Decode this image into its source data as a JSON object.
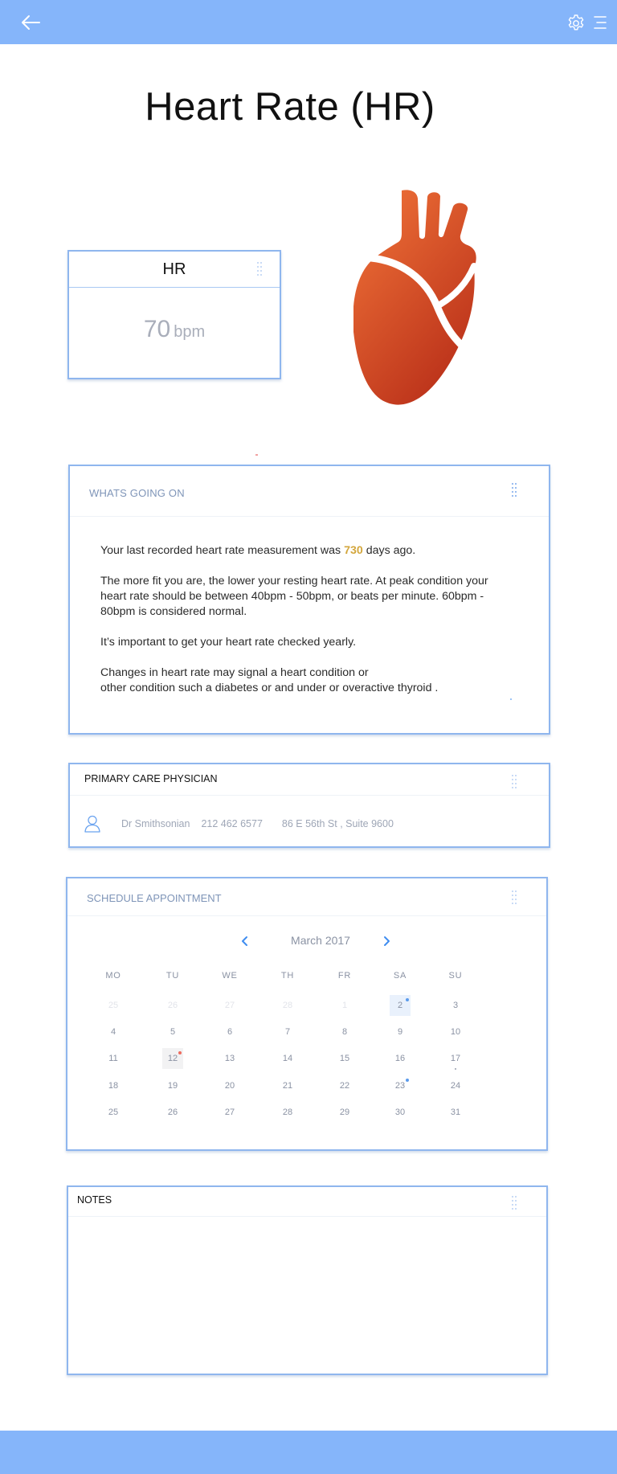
{
  "header": {
    "back_icon": "arrow-left-icon",
    "settings_icon": "gear-icon",
    "menu_icon": "hamburger-menu-icon",
    "bar_color": "#85B5FA"
  },
  "page": {
    "title": "Heart Rate (HR)"
  },
  "hr_card": {
    "label": "HR",
    "value": "70",
    "unit": "bpm"
  },
  "illustration": {
    "icon": "heart-organ-icon",
    "color": "#D94B25"
  },
  "whats_going_on": {
    "title": "WHATS GOING ON",
    "last_measurement_prefix": "Your last recorded heart rate measurement was ",
    "days_value": "730",
    "last_measurement_suffix": " days ago.",
    "fitness_lines": [
      "The more fit you are, the lower your resting heart rate.  At peak condition your",
      "heart rate should be between 40bpm - 50bpm, or beats per minute. 60bpm -",
      "80bpm is considered normal."
    ],
    "checkup": "It’s important to get your heart rate checked yearly.",
    "signal_lines": [
      "Changes in heart rate may signal a heart condition or",
      "other condition such a diabetes or and under or overactive thyroid ."
    ],
    "highlight_color": "#D3A63C"
  },
  "primary_care": {
    "title": "PRIMARY CARE PHYSICIAN",
    "avatar_icon": "user-icon",
    "name": "Dr Smithsonian",
    "phone": "212 462 6577",
    "address": "86 E 56th St , Suite 9600"
  },
  "schedule": {
    "title": "SCHEDULE APPOINTMENT",
    "month": "March 2017",
    "prev_icon": "chevron-left-icon",
    "next_icon": "chevron-right-icon",
    "weekdays": [
      "MO",
      "TU",
      "WE",
      "TH",
      "FR",
      "SA",
      "SU"
    ],
    "weeks": [
      [
        {
          "label": "25",
          "muted": true
        },
        {
          "label": "26",
          "muted": true
        },
        {
          "label": "27",
          "muted": true
        },
        {
          "label": "28",
          "muted": true
        },
        {
          "label": "1",
          "muted": true
        },
        {
          "label": "2",
          "highlight": "blue",
          "dot": "blue"
        },
        {
          "label": "3"
        }
      ],
      [
        {
          "label": "4"
        },
        {
          "label": "5"
        },
        {
          "label": "6"
        },
        {
          "label": "7"
        },
        {
          "label": "8"
        },
        {
          "label": "9"
        },
        {
          "label": "10"
        }
      ],
      [
        {
          "label": "11"
        },
        {
          "label": "12",
          "highlight": "grey",
          "dot": "red"
        },
        {
          "label": "13"
        },
        {
          "label": "14"
        },
        {
          "label": "15"
        },
        {
          "label": "16"
        },
        {
          "label": "17",
          "mini": true
        }
      ],
      [
        {
          "label": "18"
        },
        {
          "label": "19"
        },
        {
          "label": "20"
        },
        {
          "label": "21"
        },
        {
          "label": "22"
        },
        {
          "label": "23",
          "dot": "blue"
        },
        {
          "label": "24"
        }
      ],
      [
        {
          "label": "25"
        },
        {
          "label": "26"
        },
        {
          "label": "27"
        },
        {
          "label": "28"
        },
        {
          "label": "29"
        },
        {
          "label": "30"
        },
        {
          "label": "31"
        }
      ]
    ],
    "accent_blue": "#5B9BEC",
    "accent_red": "#EE6B5E"
  },
  "notes": {
    "title": "NOTES",
    "value": ""
  }
}
